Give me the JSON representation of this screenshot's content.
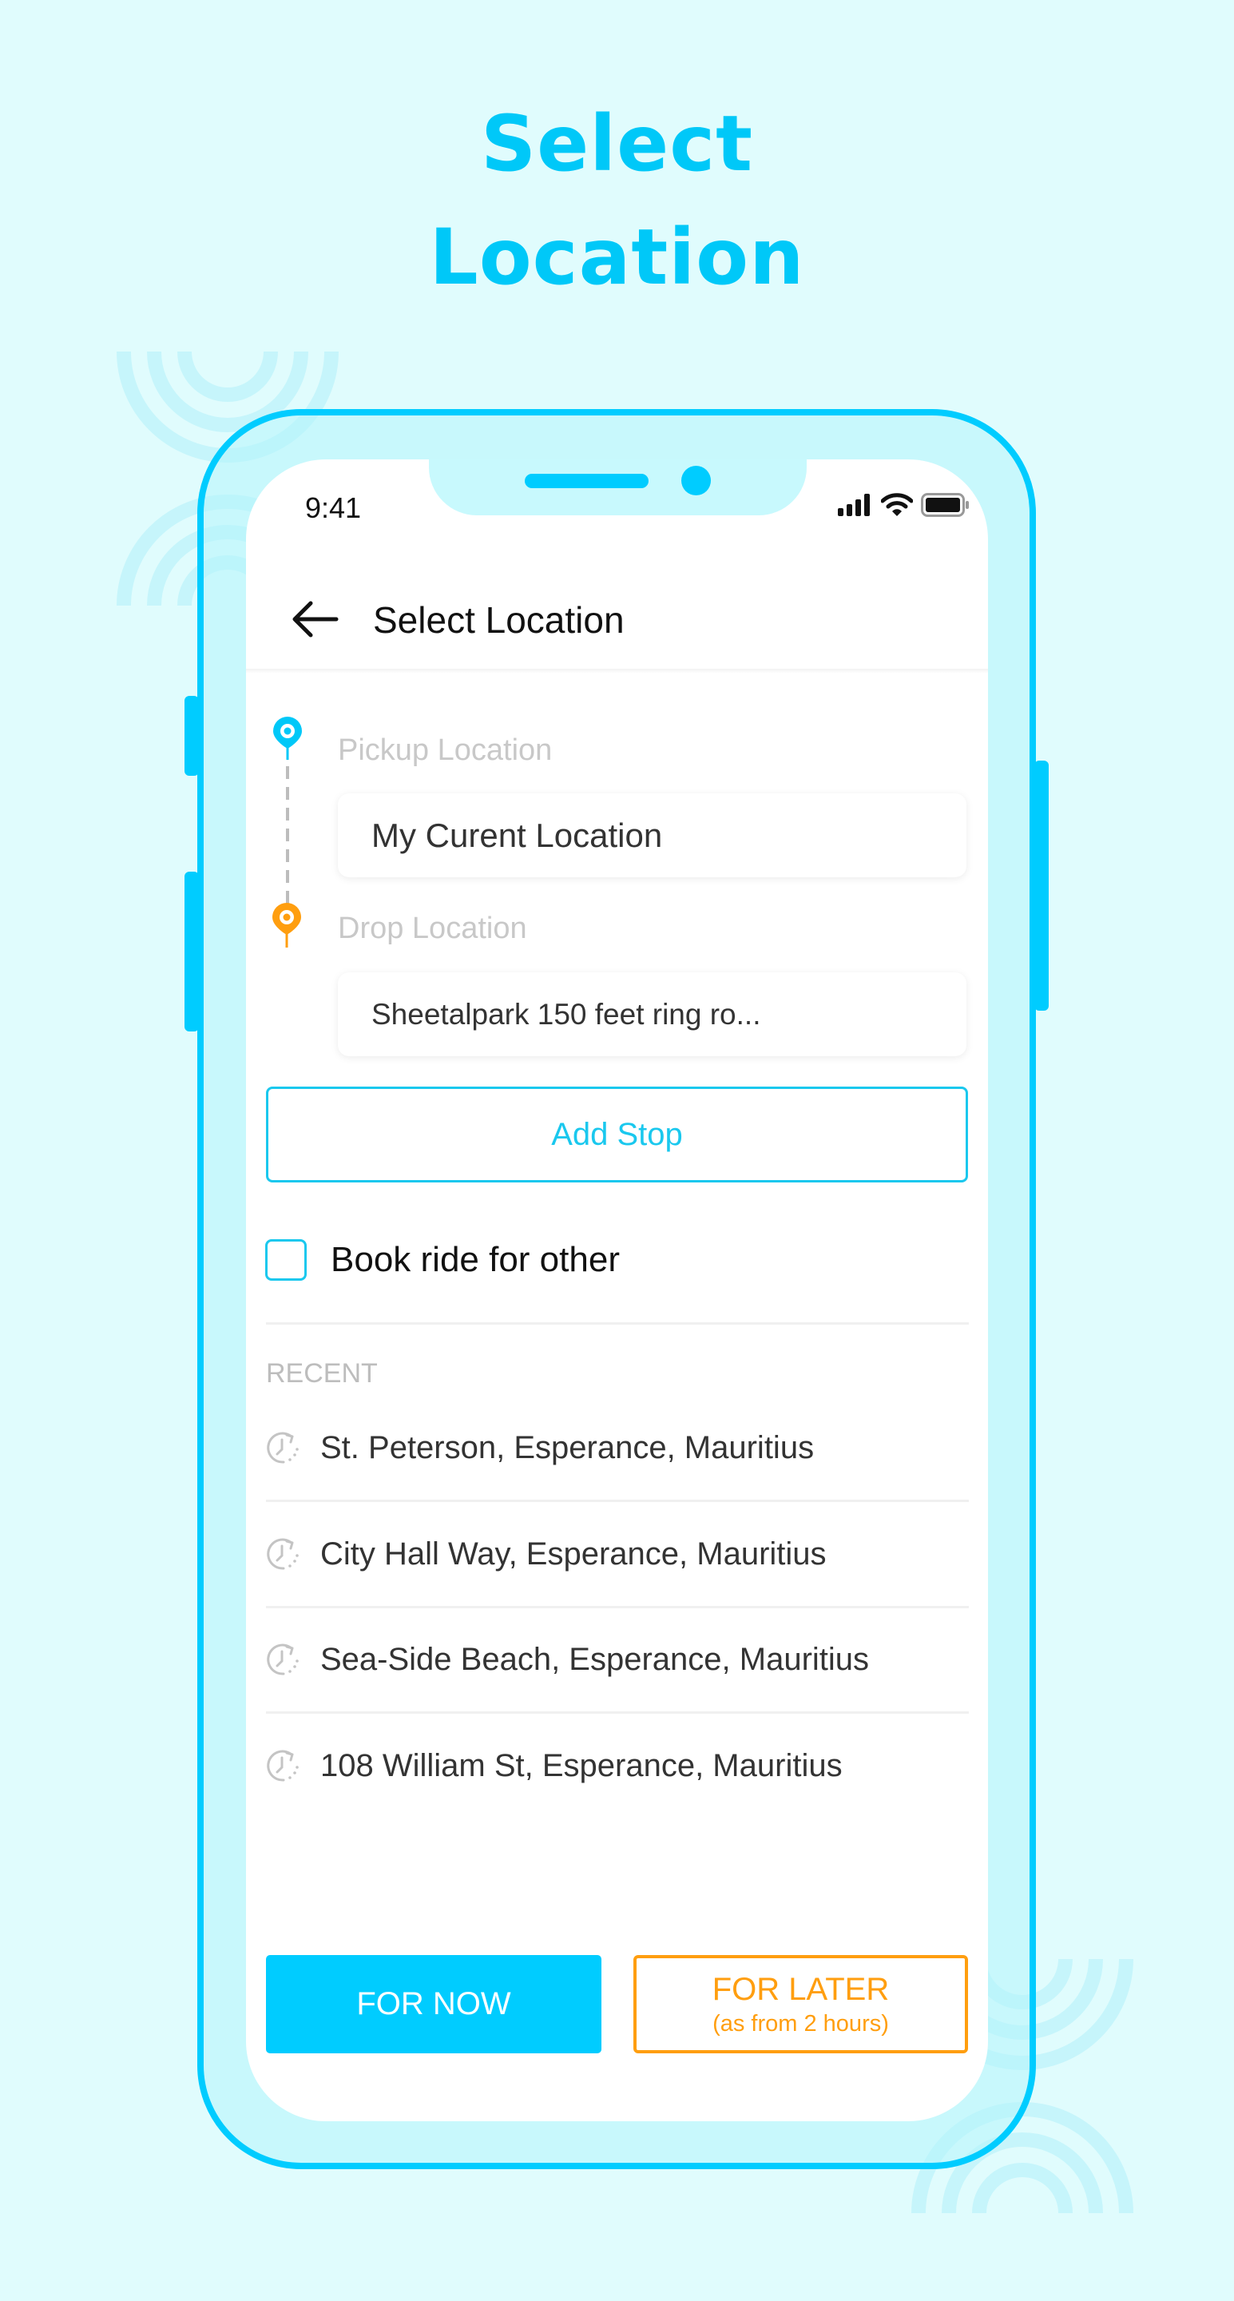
{
  "hero": {
    "title_line_1": "Select",
    "title_line_2": "Location"
  },
  "status_bar": {
    "time": "9:41",
    "icons": [
      "signal-icon",
      "wifi-icon",
      "battery-icon"
    ]
  },
  "header": {
    "back_icon": "arrow-left-icon",
    "title": "Select Location"
  },
  "route": {
    "pickup": {
      "label": "Pickup Location",
      "value": "My Curent Location",
      "pin_color": "#00C8F8"
    },
    "drop": {
      "label": "Drop Location",
      "value": "Sheetalpark 150 feet ring ro...",
      "pin_color": "#FF9E0F"
    }
  },
  "add_stop": {
    "label": "Add Stop"
  },
  "book_for_other": {
    "label": "Book ride for other",
    "checked": false
  },
  "recent": {
    "heading": "RECENT",
    "items": [
      {
        "icon": "history-icon",
        "text": "St. Peterson, Esperance, Mauritius"
      },
      {
        "icon": "history-icon",
        "text": "City Hall Way, Esperance, Mauritius"
      },
      {
        "icon": "history-icon",
        "text": "Sea-Side Beach, Esperance, Mauritius"
      },
      {
        "icon": "history-icon",
        "text": "108 William St, Esperance, Mauritius"
      }
    ]
  },
  "actions": {
    "for_now": "FOR NOW",
    "for_later": "FOR LATER",
    "for_later_sub": "(as from 2 hours)"
  },
  "colors": {
    "accent": "#00CCFF",
    "secondary": "#FF9E0F",
    "background": "#E0FCFD",
    "text": "#333333",
    "muted": "#C8C8C8"
  }
}
